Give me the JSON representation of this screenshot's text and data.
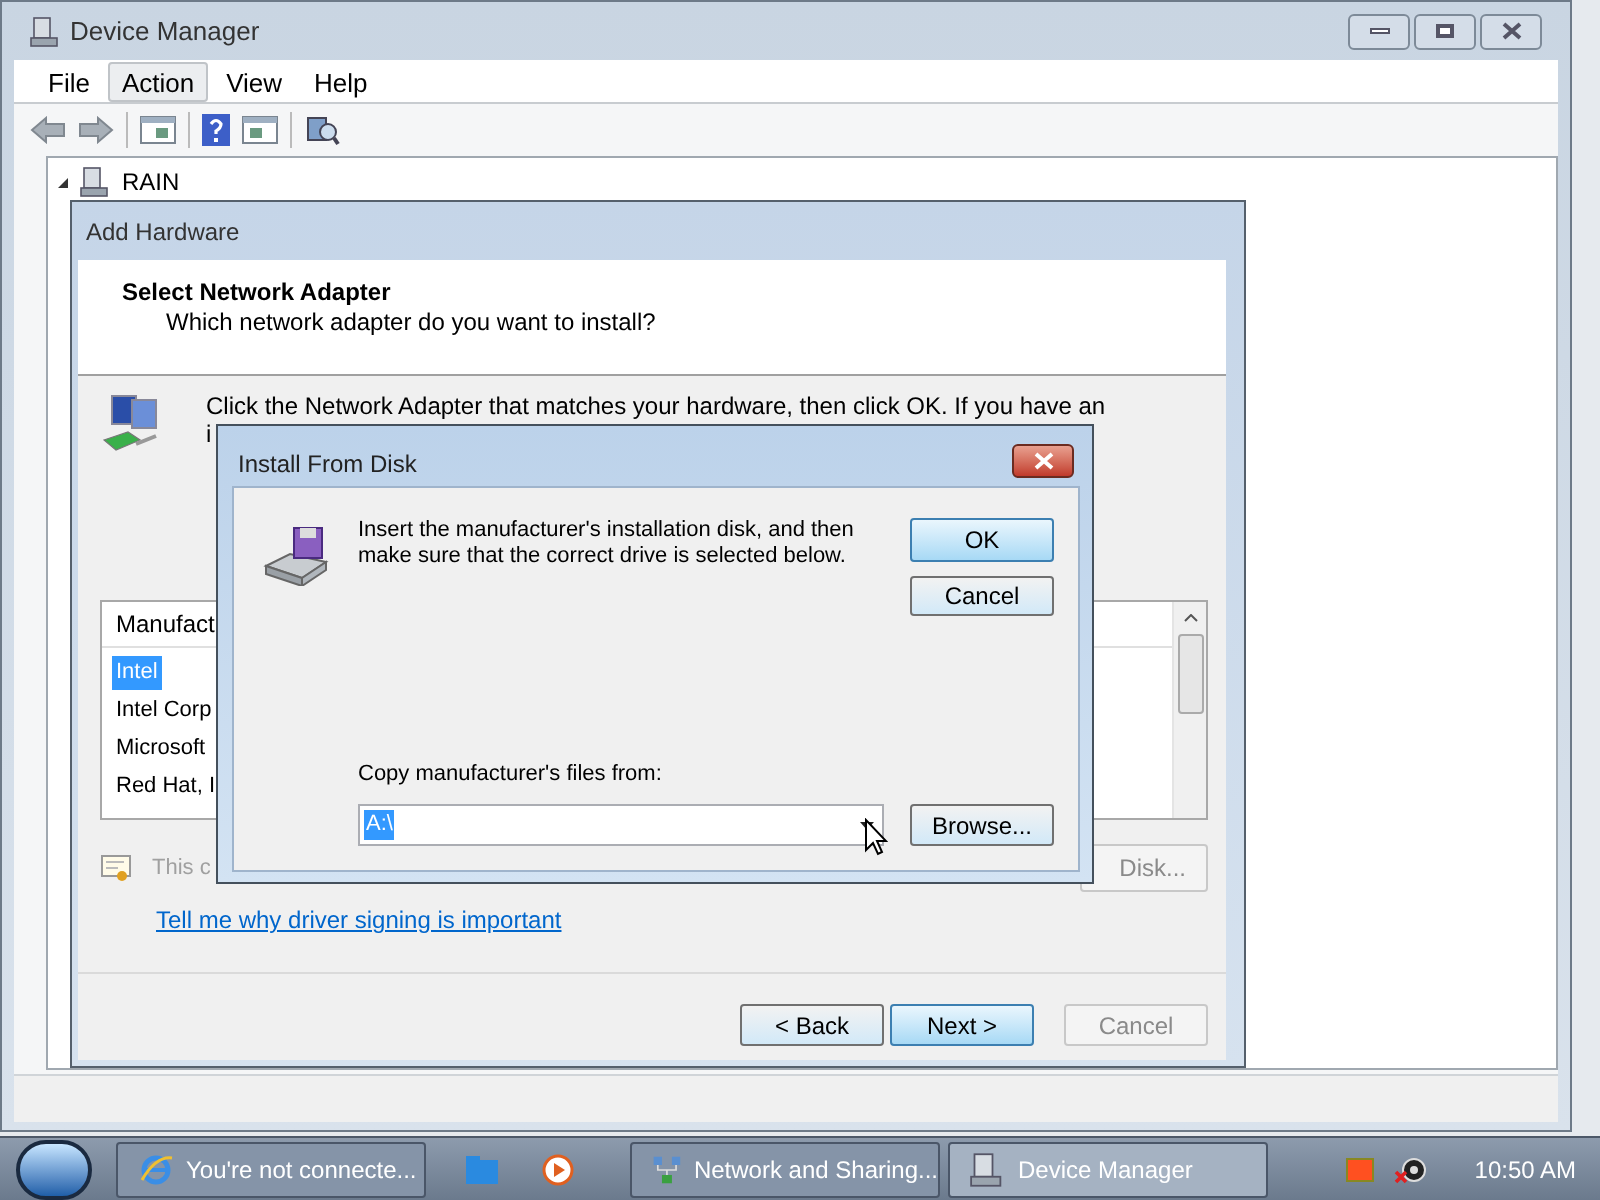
{
  "device_manager": {
    "title": "Device Manager",
    "menu": [
      {
        "label": "File",
        "selected": false
      },
      {
        "label": "Action",
        "selected": true
      },
      {
        "label": "View",
        "selected": false
      },
      {
        "label": "Help",
        "selected": false
      }
    ],
    "tree": [
      {
        "label": "RAIN",
        "expanded": true
      }
    ]
  },
  "add_hardware": {
    "title": "Add Hardware",
    "heading": "Select Network Adapter",
    "subheading": "Which network adapter do you want to install?",
    "instructions": [
      "Click the Network Adapter that matches your hardware, then click OK. If you have an",
      "i"
    ],
    "list": {
      "header": "Manufact",
      "items": [
        {
          "label": "Intel",
          "selected": true
        },
        {
          "label": "Intel Corp",
          "selected": false
        },
        {
          "label": "Microsoft",
          "selected": false
        },
        {
          "label": "Red Hat, I",
          "selected": false
        }
      ]
    },
    "signing_note": "This c",
    "have_disk_button": "Disk...",
    "link": "Tell me why driver signing is important",
    "buttons": [
      {
        "label": "< Back",
        "disabled": false,
        "default": false
      },
      {
        "label": "Next >",
        "disabled": false,
        "default": true
      },
      {
        "label": "Cancel",
        "disabled": true,
        "default": false
      }
    ]
  },
  "install_from_disk": {
    "title": "Install From Disk",
    "message": "Insert the manufacturer's installation disk, and then make sure that the correct drive is selected below.",
    "buttons": [
      {
        "label": "OK",
        "default": true
      },
      {
        "label": "Cancel",
        "default": false
      }
    ],
    "copy_label": "Copy manufacturer's files from:",
    "path": "A:\\",
    "browse_button": "Browse..."
  },
  "taskbar": {
    "items": [
      {
        "label": "You're not connecte...",
        "selected": false,
        "kind": "browser"
      },
      {
        "label": "Network and Sharing...",
        "selected": false,
        "kind": "network"
      },
      {
        "label": "Device Manager",
        "selected": true,
        "kind": "device"
      }
    ],
    "clock": "10:50 AM"
  }
}
